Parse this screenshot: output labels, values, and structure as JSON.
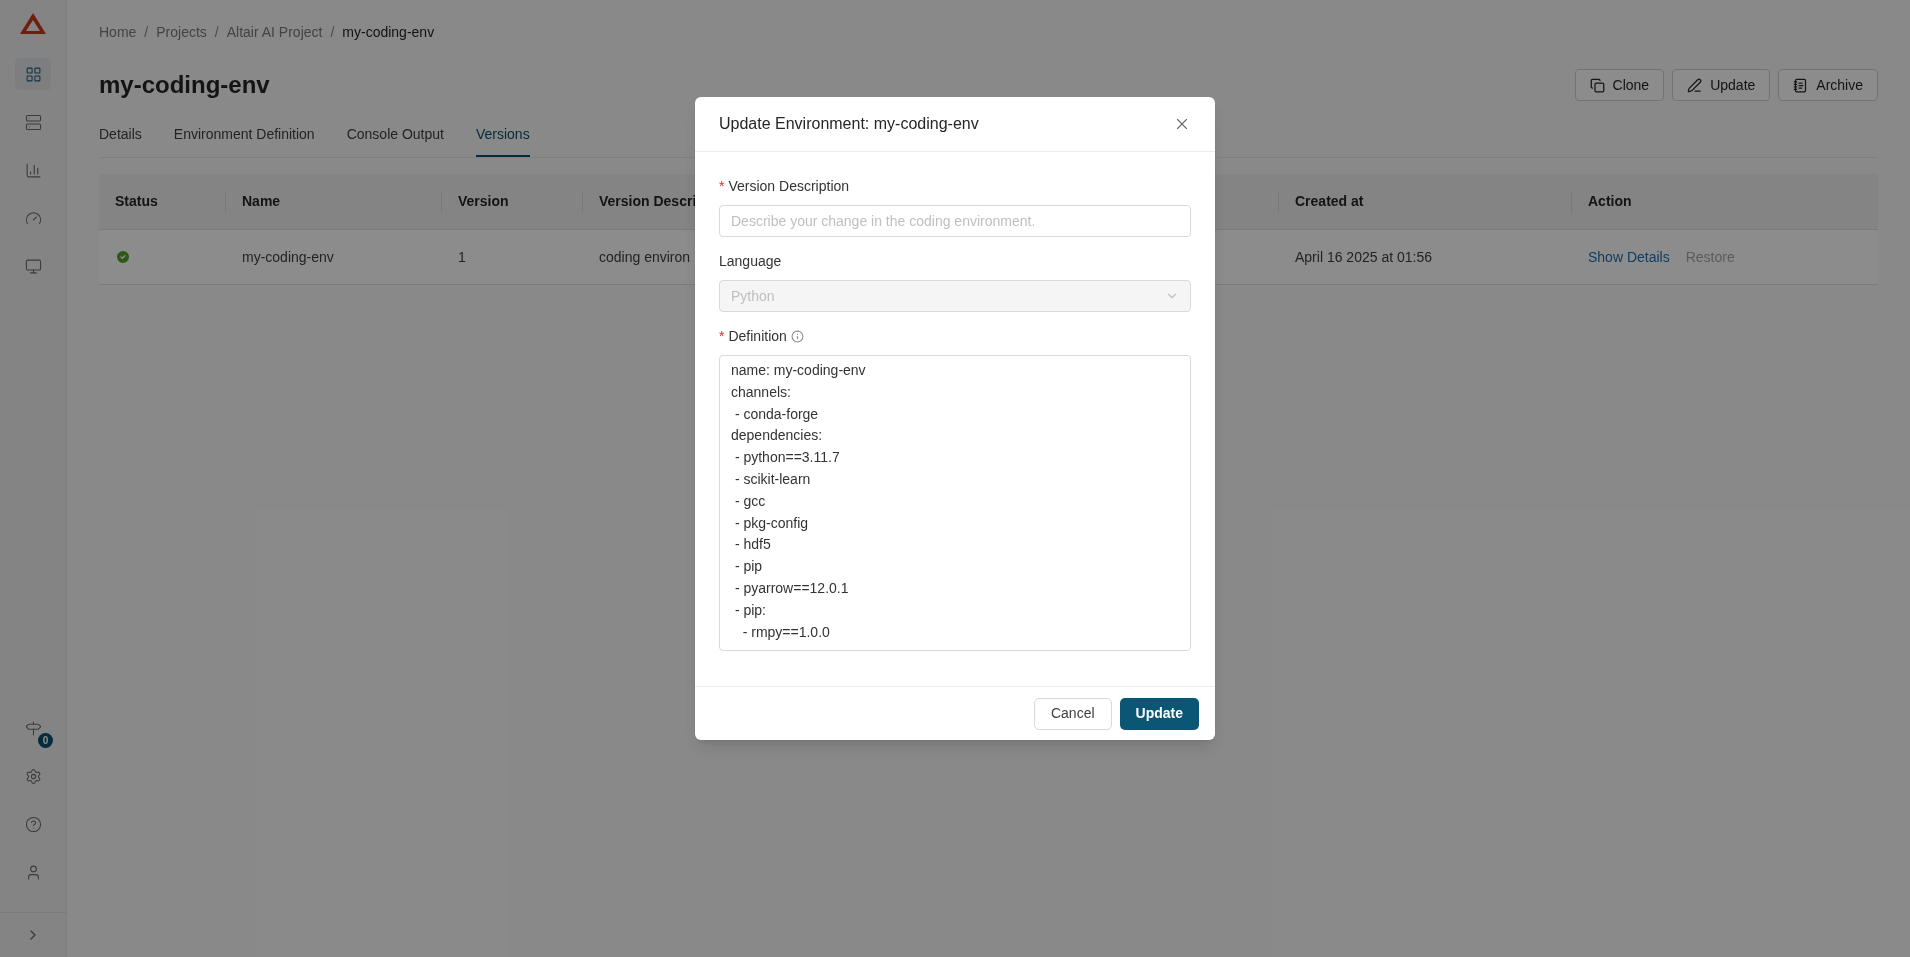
{
  "sidebar": {
    "items": [
      {
        "kind": "grid",
        "selected": true
      },
      {
        "kind": "list",
        "selected": false
      },
      {
        "kind": "chart",
        "selected": false
      },
      {
        "kind": "gauge",
        "selected": false
      },
      {
        "kind": "monitor",
        "selected": false
      }
    ],
    "bottom_items": [
      {
        "kind": "signpost",
        "badge": "0"
      },
      {
        "kind": "gear"
      },
      {
        "kind": "help"
      },
      {
        "kind": "user"
      }
    ]
  },
  "breadcrumb": [
    {
      "label": "Home",
      "current": false
    },
    {
      "separator": "/",
      "label": "Projects",
      "current": false
    },
    {
      "separator": "/",
      "label": "Altair AI Project",
      "current": false
    },
    {
      "separator": "/",
      "label": "my-coding-env",
      "current": true
    }
  ],
  "page_title": "my-coding-env",
  "header_buttons": [
    {
      "label": "Clone",
      "kind": "copy"
    },
    {
      "label": "Update",
      "kind": "edit"
    },
    {
      "label": "Archive",
      "kind": "archive"
    }
  ],
  "tabs": [
    {
      "label": "Details",
      "selected": false
    },
    {
      "label": "Environment Definition",
      "selected": false
    },
    {
      "label": "Console Output",
      "selected": false
    },
    {
      "label": "Versions",
      "selected": true
    }
  ],
  "table": {
    "columns": [
      "Status",
      "Name",
      "Version",
      "Version Descri",
      "Created at",
      "Action"
    ],
    "rows": [
      {
        "kind": "success",
        "name": "my-coding-env",
        "version": "1",
        "description": "coding environ",
        "created_at": "April 16 2025 at 01:56",
        "actions": [
          {
            "label": "Show Details",
            "disabled": false
          },
          {
            "label": "Restore",
            "disabled": true
          }
        ]
      }
    ]
  },
  "modal": {
    "title": "Update Environment: my-coding-env",
    "fields": [
      {
        "kind": "text",
        "label": "Version Description",
        "required_mark": "*",
        "placeholder": "Describe your change in the coding environment."
      },
      {
        "kind": "select",
        "label": "Language",
        "value": "Python",
        "disabled": true
      },
      {
        "kind": "code",
        "label": "Definition",
        "required_mark": "*",
        "info": true,
        "lines": [
          "name: my-coding-env",
          "channels:",
          " - conda-forge",
          "dependencies:",
          " - python==3.11.7",
          " - scikit-learn",
          " - gcc",
          " - pkg-config",
          " - hdf5",
          " - pip",
          " - pyarrow==12.0.1",
          " - pip:",
          "   - rmpy==1.0.0"
        ]
      }
    ],
    "buttons": [
      {
        "label": "Cancel",
        "kind": "secondary"
      },
      {
        "label": "Update",
        "kind": "primary"
      }
    ]
  }
}
